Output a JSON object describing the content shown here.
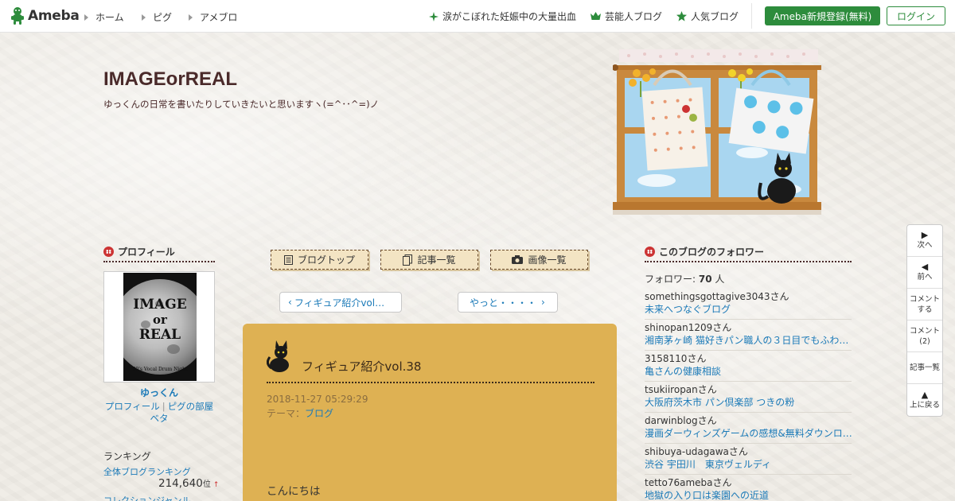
{
  "header": {
    "logo_text": "Ameba",
    "nav": [
      "ホーム",
      "ピグ",
      "アメブロ"
    ],
    "links": [
      {
        "label": "涙がこぼれた妊娠中の大量出血",
        "icon": "sparkle-icon"
      },
      {
        "label": "芸能人ブログ",
        "icon": "crown-icon"
      },
      {
        "label": "人気ブログ",
        "icon": "star-icon"
      }
    ],
    "register_label": "Ameba新規登録(無料)",
    "login_label": "ログイン"
  },
  "blog": {
    "title": "IMAGEorREAL",
    "description": "ゆっくんの日常を書いたりしていきたいと思いますヽ(=^･･^=)ノ"
  },
  "profile": {
    "heading": "プロフィール",
    "image_lines": [
      "IMAGE",
      "or",
      "REAL"
    ],
    "image_caption": "90's Vocal Drum Night",
    "name": "ゆっくん",
    "link_profile": "プロフィール",
    "link_room": "ピグの部屋",
    "link_room_suffix": "ベタ"
  },
  "ranking": {
    "heading": "ランキング",
    "overall_label": "全体ブログランキング",
    "overall_value": "214,640",
    "overall_unit": "位",
    "overall_trend": "↑",
    "collection_label": "コレクションジャンル"
  },
  "blog_nav": {
    "top_label": "ブログトップ",
    "list_label": "記事一覧",
    "images_label": "画像一覧"
  },
  "pager": {
    "prev_label": "フィギュア紹介vol…",
    "next_label": "やっと・・・・"
  },
  "article": {
    "title": "フィギュア紹介vol.38",
    "date": "2018-11-27 05:29:29",
    "theme_prefix": "テーマ：",
    "theme": "ブログ",
    "body_first": "こんにちは"
  },
  "followers": {
    "heading": "このブログのフォロワー",
    "count_prefix": "フォロワー: ",
    "count": "70",
    "count_suffix": " 人",
    "items": [
      {
        "name": "somethingsgottagive3043",
        "suffix": "さん",
        "blog": "未来へつなぐブログ"
      },
      {
        "name": "shinopan1209",
        "suffix": "さん",
        "blog": "湘南茅ヶ崎 猫好きパン職人の３日目でもふわ…"
      },
      {
        "name": "3158110",
        "suffix": "さん",
        "blog": "亀さんの健康相談"
      },
      {
        "name": "tsukiiropan",
        "suffix": "さん",
        "blog": "大阪府茨木市 パン倶楽部 つきの粉"
      },
      {
        "name": "darwinblog",
        "suffix": "さん",
        "blog": "漫画ダーウィンズゲームの感想&無料ダウンロ…"
      },
      {
        "name": "shibuya-udagawa",
        "suffix": "さん",
        "blog": "渋谷 宇田川　東京ヴェルディ"
      },
      {
        "name": "tetto76ameba",
        "suffix": "さん",
        "blog": "地獄の入り口は楽園への近道"
      }
    ]
  },
  "float_bar": {
    "next": "次へ",
    "prev": "前へ",
    "comment": "コメントする",
    "comment_1": "コメント",
    "comment_2": "する",
    "comments_1": "コメント",
    "comments_2": "(2)",
    "article_list": "記事一覧",
    "back_top": "上に戻る"
  },
  "colors": {
    "ameba_green": "#2d8c3c",
    "article_bg": "#deb153",
    "link": "#1b7ab8",
    "title_brown": "#4a2a2a"
  }
}
